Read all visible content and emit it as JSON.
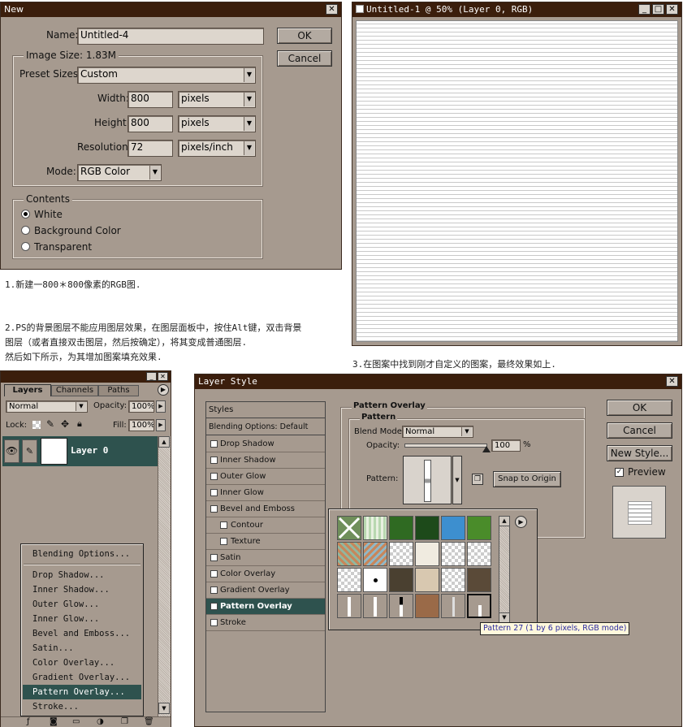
{
  "new_dialog": {
    "title": "New",
    "close": "✕",
    "name_label": "Name:",
    "name_value": "Untitled-4",
    "ok": "OK",
    "cancel": "Cancel",
    "image_size_label": "Image Size: 1.83M",
    "preset_label": "Preset Sizes:",
    "preset_value": "Custom",
    "width_label": "Width:",
    "width_value": "800",
    "width_unit": "pixels",
    "height_label": "Height:",
    "height_value": "800",
    "height_unit": "pixels",
    "resolution_label": "Resolution:",
    "resolution_value": "72",
    "resolution_unit": "pixels/inch",
    "mode_label": "Mode:",
    "mode_value": "RGB Color",
    "contents_label": "Contents",
    "contents_options": [
      "White",
      "Background Color",
      "Transparent"
    ]
  },
  "doc_window": {
    "title": "Untitled-1 @ 50% (Layer 0, RGB)",
    "min": "_",
    "max": "□",
    "close": "✕"
  },
  "captions": {
    "step1": "1.新建一800＊800像素的RGB图.",
    "step2_line1": "2.PS的背景图层不能应用图层效果，在图层面板中，按住Alt键，双击背景",
    "step2_line2": "图层（或者直接双击图层，然后按确定），将其变成普通图层.",
    "step2_line3": "然后如下所示，为其增加图案填充效果.",
    "step3": "3.在图案中找到刚才自定义的图案，最终效果如上."
  },
  "layers_panel": {
    "tabs": [
      "Layers",
      "Channels",
      "Paths"
    ],
    "blend_mode": "Normal",
    "opacity_label": "Opacity:",
    "opacity_value": "100%",
    "lock_label": "Lock:",
    "fill_label": "Fill:",
    "fill_value": "100%",
    "layer_name": "Layer 0",
    "menu_items": [
      "Blending Options...",
      "Drop Shadow...",
      "Inner Shadow...",
      "Outer Glow...",
      "Inner Glow...",
      "Bevel and Emboss...",
      "Satin...",
      "Color Overlay...",
      "Gradient Overlay...",
      "Pattern Overlay...",
      "Stroke..."
    ]
  },
  "layer_style": {
    "title": "Layer Style",
    "close": "✕",
    "styles_header": "Styles",
    "blending_default": "Blending Options: Default",
    "items": [
      {
        "label": "Drop Shadow",
        "checked": false
      },
      {
        "label": "Inner Shadow",
        "checked": false
      },
      {
        "label": "Outer Glow",
        "checked": false
      },
      {
        "label": "Inner Glow",
        "checked": false
      },
      {
        "label": "Bevel and Emboss",
        "checked": false
      },
      {
        "label": "Contour",
        "checked": false
      },
      {
        "label": "Texture",
        "checked": false
      },
      {
        "label": "Satin",
        "checked": false
      },
      {
        "label": "Color Overlay",
        "checked": false
      },
      {
        "label": "Gradient Overlay",
        "checked": false
      },
      {
        "label": "Pattern Overlay",
        "checked": true
      },
      {
        "label": "Stroke",
        "checked": false
      }
    ],
    "section_title": "Pattern Overlay",
    "sub_title": "Pattern",
    "blend_mode_label": "Blend Mode:",
    "blend_mode_value": "Normal",
    "opacity_label": "Opacity:",
    "opacity_value": "100",
    "percent": "%",
    "pattern_label": "Pattern:",
    "snap_button": "Snap to Origin",
    "ok": "OK",
    "cancel": "Cancel",
    "new_style": "New Style...",
    "preview_label": "Preview",
    "tooltip": "Pattern 27 (1 by 6 pixels, RGB mode)"
  }
}
